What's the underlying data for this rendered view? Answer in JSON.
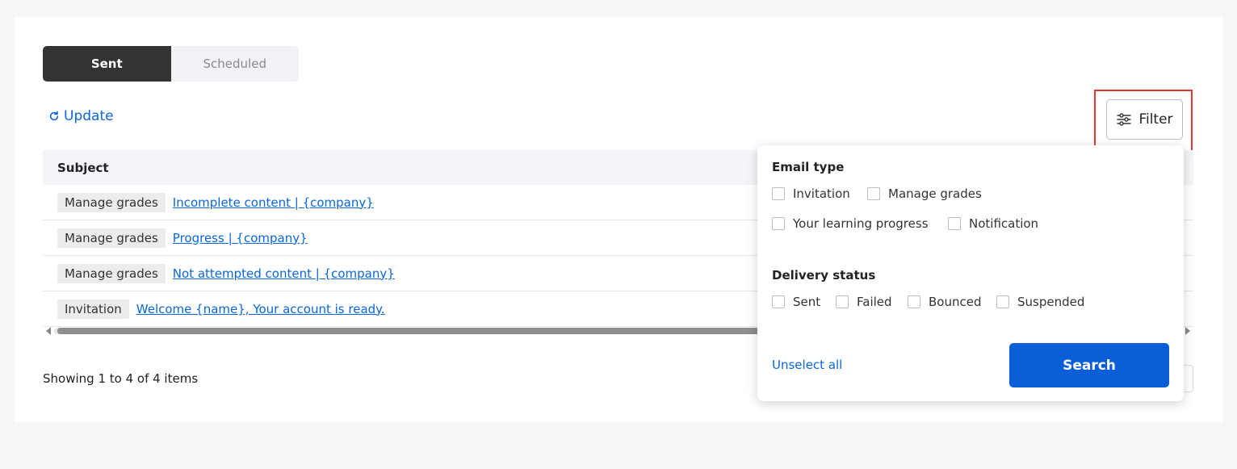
{
  "tabs": [
    {
      "label": "Sent",
      "active": true
    },
    {
      "label": "Scheduled",
      "active": false
    }
  ],
  "toolbar": {
    "update_label": "Update",
    "filter_label": "Filter",
    "update_icon": "refresh-icon",
    "filter_icon": "sliders-icon"
  },
  "table": {
    "columns": [
      "Subject"
    ],
    "rows": [
      {
        "type": "Manage grades",
        "subject": "Incomplete content | {company}"
      },
      {
        "type": "Manage grades",
        "subject": "Progress | {company}"
      },
      {
        "type": "Manage grades",
        "subject": "Not attempted content | {company}"
      },
      {
        "type": "Invitation",
        "subject": "Welcome {name}, Your account is ready."
      }
    ]
  },
  "footer": {
    "showing_text": "Showing 1 to 4 of 4 items"
  },
  "filter_panel": {
    "email_type": {
      "title": "Email type",
      "options": [
        "Invitation",
        "Manage grades",
        "Your learning progress",
        "Notification"
      ]
    },
    "delivery_status": {
      "title": "Delivery status",
      "options": [
        "Sent",
        "Failed",
        "Bounced",
        "Suspended"
      ]
    },
    "unselect_label": "Unselect all",
    "search_label": "Search"
  },
  "colors": {
    "accent": "#0a66d8",
    "primary_button": "#0a5fd9",
    "active_tab": "#333333",
    "highlight": "#e53935"
  }
}
